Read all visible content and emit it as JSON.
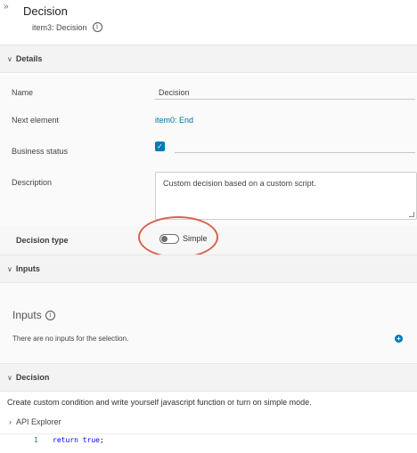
{
  "header": {
    "collapse_glyph": "»",
    "title": "Decision",
    "subtitle": "item3: Decision"
  },
  "sections": {
    "details": "Details",
    "inputs": "Inputs",
    "decision": "Decision"
  },
  "details": {
    "name_label": "Name",
    "name_value": "Decision",
    "next_element_label": "Next element",
    "next_element_value": "item0: End",
    "business_status_label": "Business status",
    "business_status_checked": true,
    "description_label": "Description",
    "description_value": "Custom decision based on a custom script."
  },
  "decision_type": {
    "label": "Decision type",
    "toggle_label": "Simple",
    "toggle_on": false
  },
  "inputs": {
    "heading": "Inputs",
    "empty_text": "There are no inputs for the selection."
  },
  "decision": {
    "description": "Create custom condition and write yourself javascript function or turn on simple mode.",
    "api_explorer": "API Explorer",
    "code_lines": [
      {
        "number": "1",
        "keyword": "return",
        "value": "true",
        "terminator": ";"
      }
    ]
  },
  "colors": {
    "accent": "#0079b8",
    "link": "#0072a3",
    "highlight": "#d8624f",
    "section_bg": "#f3f3f3"
  }
}
